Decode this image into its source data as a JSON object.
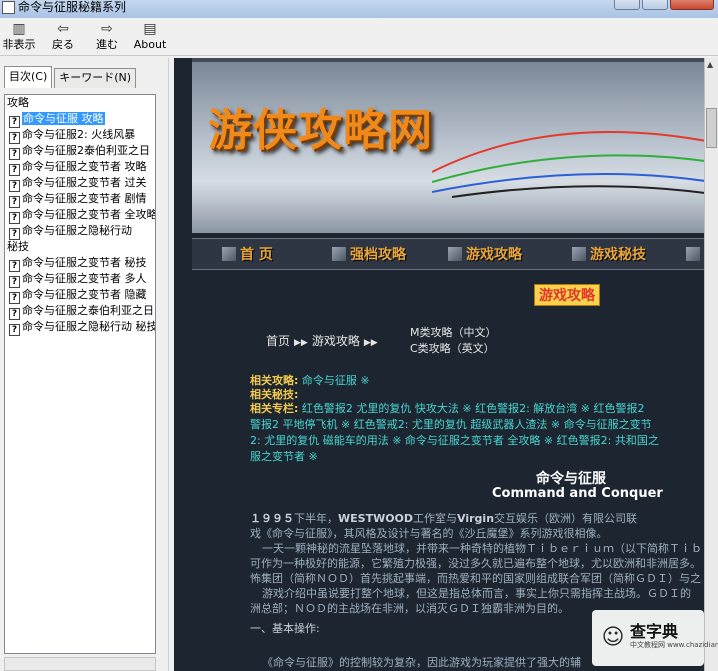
{
  "window": {
    "title": "命令与征服秘籍系列"
  },
  "toolbar": {
    "hide_label": "非表示",
    "back_label": "戻る",
    "forward_label": "進む",
    "about_label": "About"
  },
  "tabs": {
    "contents": "目次(C)",
    "keyword": "キーワード(N)"
  },
  "tree": {
    "group1": "攻略",
    "items1": [
      "命令与征服 攻略",
      "命令与征服2: 火线风暴",
      "命令与征服2泰伯利亚之日",
      "命令与征服之变节者 攻略",
      "命令与征服之变节者 过关",
      "命令与征服之变节者 剧情",
      "命令与征服之变节者 全攻略",
      "命令与征服之隐秘行动"
    ],
    "group2": "秘技",
    "items2": [
      "命令与征服之变节者 秘技",
      "命令与征服之变节者 多人",
      "命令与征服之变节者 隐藏",
      "命令与征服之泰伯利亚之日",
      "命令与征服之隐秘行动 秘技"
    ]
  },
  "site": {
    "logo": "游侠攻略网",
    "nav": [
      "首 页",
      "强档攻略",
      "游戏攻略",
      "游戏秘技",
      "游"
    ],
    "section_badge": "游戏攻略",
    "crumb_home": "首页",
    "crumb_section": "游戏攻略",
    "lang_cn": "M类攻略（中文）",
    "lang_en": "C类攻略（英文）"
  },
  "related": {
    "guides_label": "相关攻略:",
    "guides_link": "命令与征服",
    "mark": "※",
    "cheats_label": "相关秘技:",
    "topics_label": "相关专栏:",
    "topics_line1": "红色警报2 尤里的复仇 快攻大法 ※ 红色警报2: 解放台湾 ※ 红色警报2",
    "topics_line2": "警报2 平地停飞机 ※ 红色警戒2: 尤里的复仇 超级武器人渣法 ※ 命令与征服之变节",
    "topics_line3": "2: 尤里的复仇 磁能车的用法 ※ 命令与征服之变节者 全攻略 ※ 红色警报2: 共和国之",
    "topics_line4": "服之变节者 ※"
  },
  "article": {
    "title": "命令与征服",
    "subtitle": "Command and Conquer",
    "p1_line1_a": "１９９５",
    "p1_line1_b": "下半年，",
    "p1_line1_c": "WESTWOOD",
    "p1_line1_d": "工作室与",
    "p1_line1_e": "Virgin",
    "p1_line1_f": "交互娱乐（欧洲）有限公司联",
    "p1_line2": "戏《命令与征服》，其风格及设计与著名的《沙丘魔堡》系列游戏很相像。",
    "p2_line1": "一天一颗神秘的流星坠落地球，并带来一种奇特的植物Ｔｉｂｅｒｉｕｍ（以下简称Ｔｉｂ",
    "p2_line2": "可作为一种极好的能源，它繁殖力极强，没过多久就已遍布整个地球，尤以欧洲和非洲居多。",
    "p2_line3": "怖集团（简称ＮＯＤ）首先挑起事端，而热爱和平的国家则组成联合军团（简称ＧＤＩ）与之",
    "p2_line4": "游戏介绍中虽说要打整个地球，但这是指总体而言，事实上你只需指挥主战场。ＧＤＩ的",
    "p2_line5": "洲总部；ＮＯＤ的主战场在非洲，以消灭ＧＤＩ独霸非洲为目的。",
    "section1": "一、基本操作:",
    "p3_line1": "《命令与征服》的控制较为复杂，因此游戏为玩家提供了强大的辅"
  },
  "watermark": {
    "brand": "查字典",
    "sub": "中文教程网 www.chazidian.com"
  }
}
